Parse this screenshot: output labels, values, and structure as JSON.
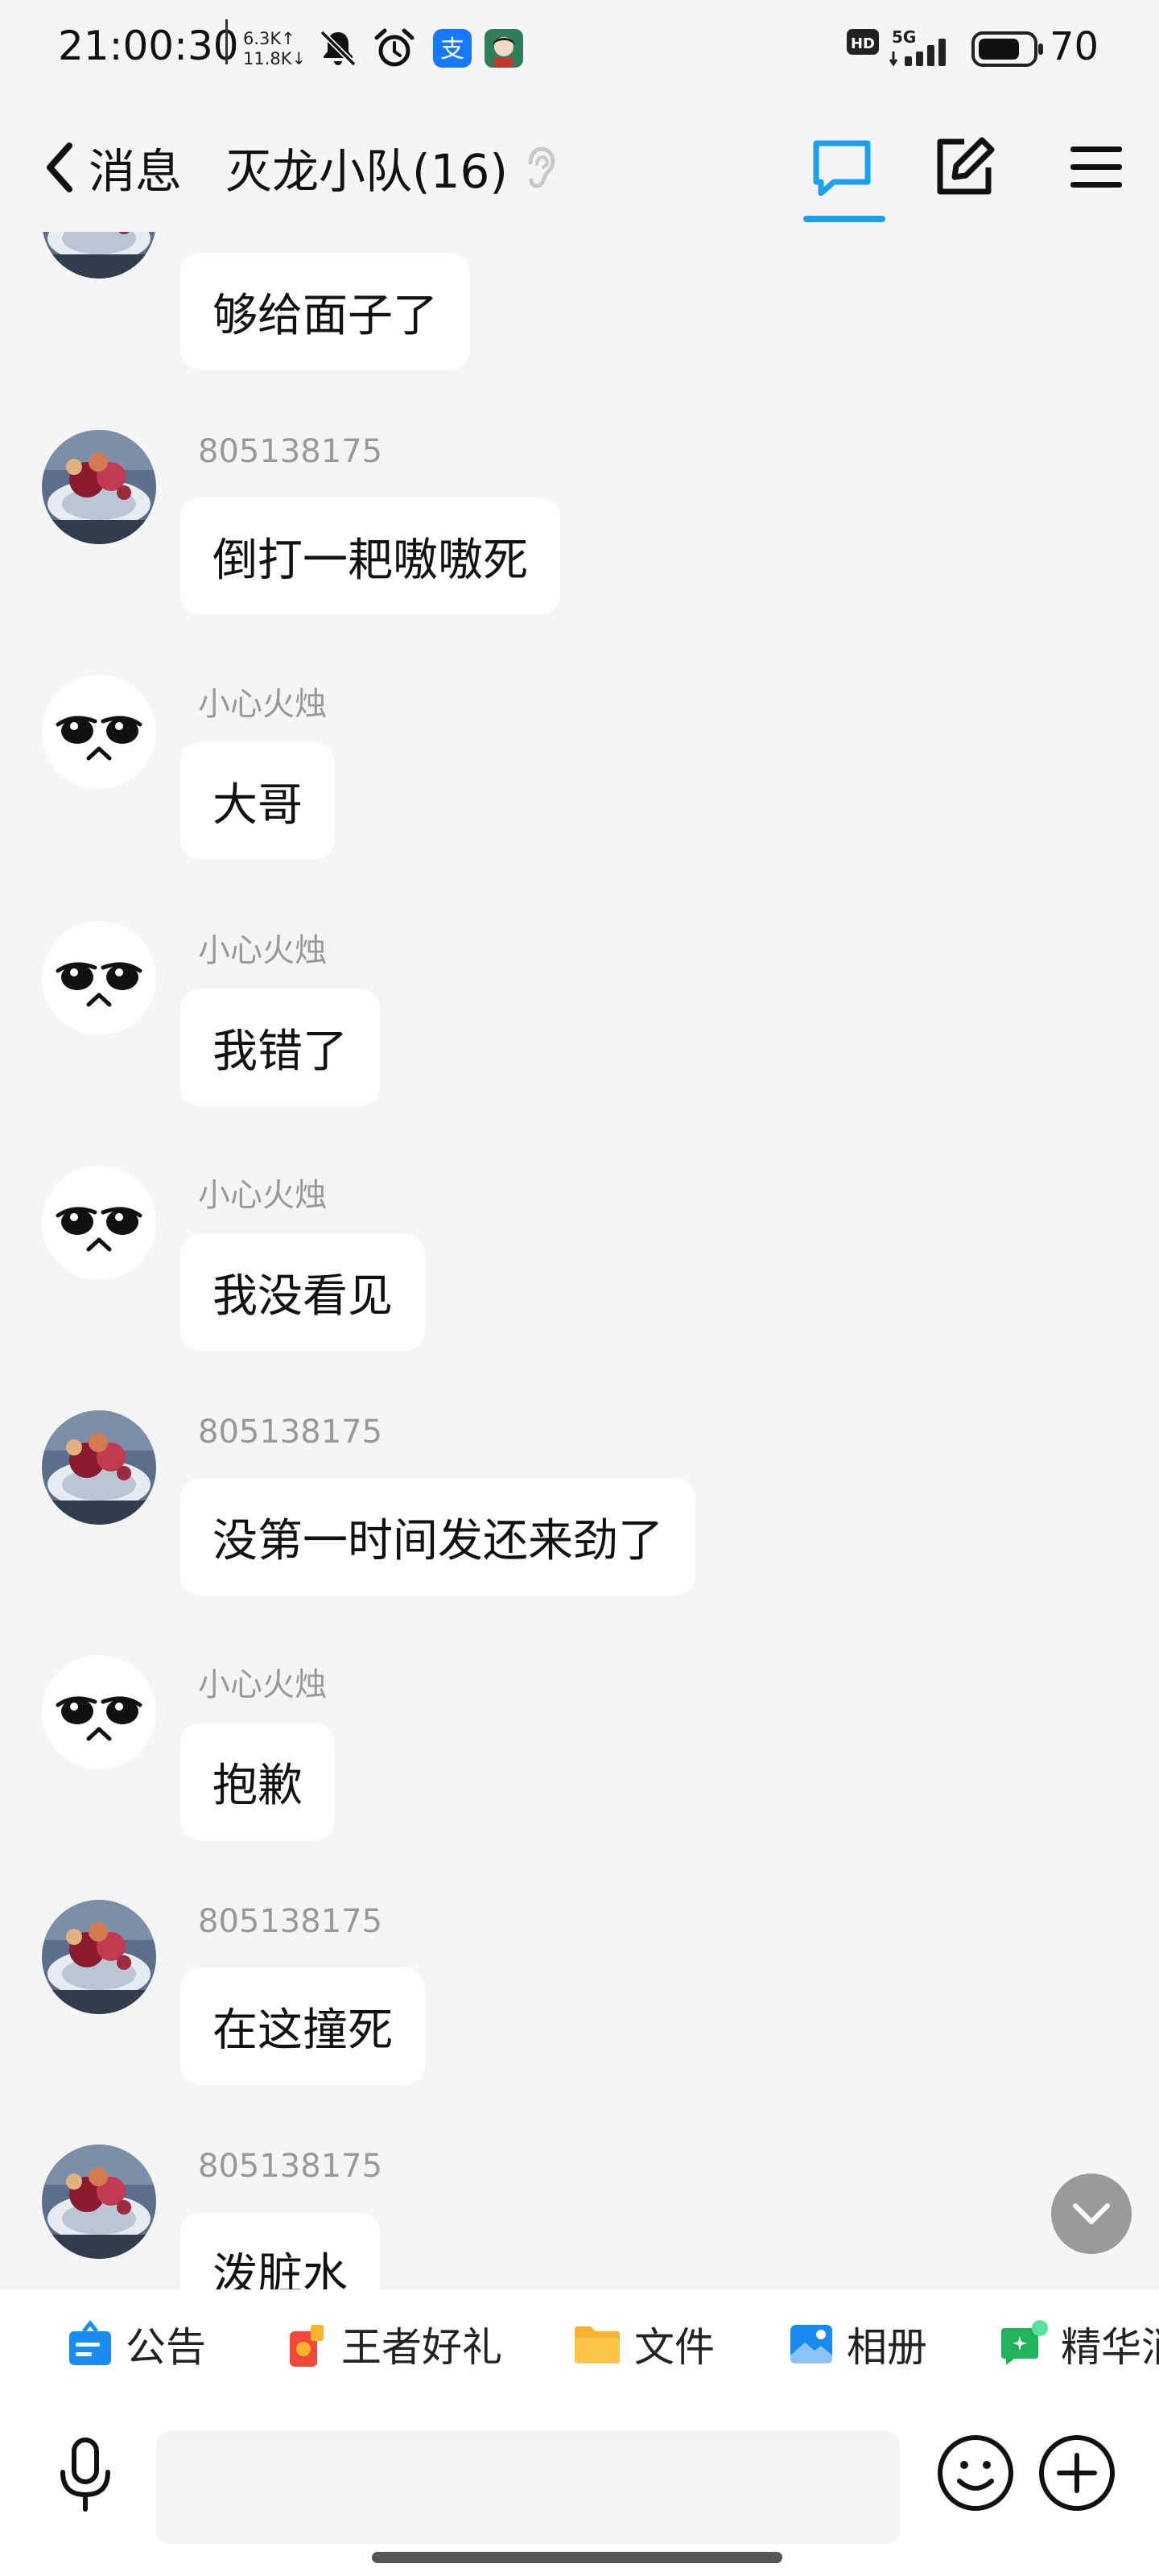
{
  "status_bar": {
    "time": "21:00:30",
    "net_up": "6.3K↑",
    "net_down": "11.8K↓",
    "hd": "HD",
    "network": "5G",
    "battery": "70",
    "icons": [
      "bell-off-icon",
      "alarm-clock-icon",
      "alipay-icon",
      "app-avatar-icon",
      "signal-icon",
      "battery-icon"
    ]
  },
  "header": {
    "back_label": "消息",
    "title": "灭龙小队(16)",
    "icons": [
      "chevron-left-icon",
      "ear-icon",
      "chat-bubble-icon",
      "edit-icon",
      "menu-icon"
    ],
    "accent": "#1aa0ec"
  },
  "messages": [
    {
      "sender": "",
      "avatar": "photo",
      "text": "够给面子了"
    },
    {
      "sender": "805138175",
      "avatar": "photo",
      "text": "倒打一耙嗷嗷死"
    },
    {
      "sender": "小心火烛",
      "avatar": "cartoon-face",
      "text": "大哥"
    },
    {
      "sender": "小心火烛",
      "avatar": "cartoon-face",
      "text": "我错了"
    },
    {
      "sender": "小心火烛",
      "avatar": "cartoon-face",
      "text": "我没看见"
    },
    {
      "sender": "805138175",
      "avatar": "photo",
      "text": "没第一时间发还来劲了"
    },
    {
      "sender": "小心火烛",
      "avatar": "cartoon-face",
      "text": "抱歉"
    },
    {
      "sender": "805138175",
      "avatar": "photo",
      "text": "在这撞死"
    },
    {
      "sender": "805138175",
      "avatar": "photo",
      "text": "泼脏水"
    }
  ],
  "quick_bar": {
    "items": [
      {
        "label": "公告",
        "icon": "announcement-icon"
      },
      {
        "label": "王者好礼",
        "icon": "gift-icon"
      },
      {
        "label": "文件",
        "icon": "folder-icon"
      },
      {
        "label": "相册",
        "icon": "album-icon"
      },
      {
        "label": "精华消",
        "icon": "essence-icon"
      }
    ]
  },
  "input_bar": {
    "placeholder": "",
    "icons": [
      "microphone-icon",
      "emoji-icon",
      "plus-icon"
    ]
  }
}
